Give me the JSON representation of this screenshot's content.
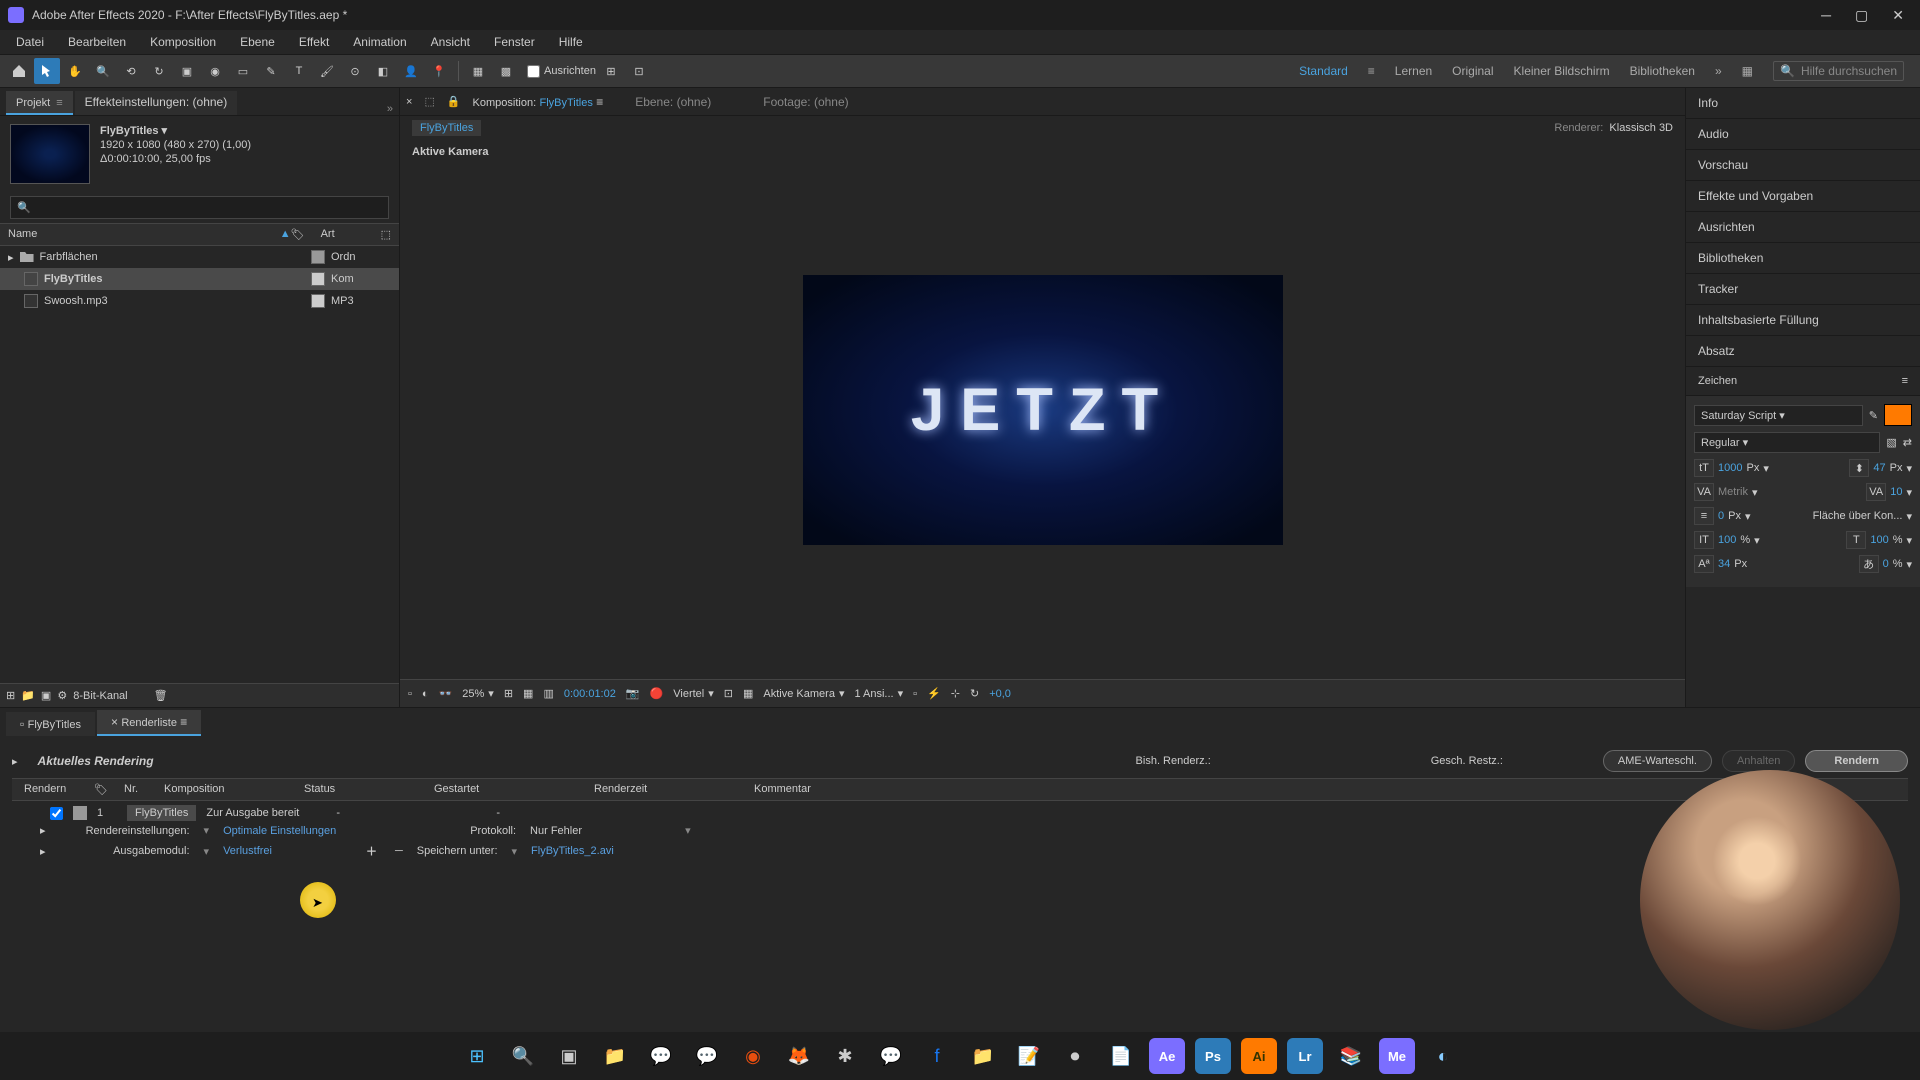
{
  "titlebar": {
    "title": "Adobe After Effects 2020 - F:\\After Effects\\FlyByTitles.aep *"
  },
  "menu": [
    "Datei",
    "Bearbeiten",
    "Komposition",
    "Ebene",
    "Effekt",
    "Animation",
    "Ansicht",
    "Fenster",
    "Hilfe"
  ],
  "toolbar": {
    "snap_label": "Ausrichten",
    "search_placeholder": "Hilfe durchsuchen"
  },
  "workspaces": {
    "items": [
      "Standard",
      "Lernen",
      "Original",
      "Kleiner Bildschirm",
      "Bibliotheken"
    ],
    "active": "Standard"
  },
  "project": {
    "tab_project": "Projekt",
    "tab_effects": "Effekteinstellungen: (ohne)",
    "comp_name": "FlyByTitles",
    "comp_res": "1920 x 1080 (480 x 270) (1,00)",
    "comp_time": "Δ0:00:10:00, 25,00 fps",
    "col_name": "Name",
    "col_type": "Art",
    "items": [
      {
        "name": "Farbflächen",
        "type": "Ordn",
        "kind": "folder"
      },
      {
        "name": "FlyByTitles",
        "type": "Kom",
        "kind": "comp",
        "selected": true
      },
      {
        "name": "Swoosh.mp3",
        "type": "MP3",
        "kind": "audio"
      }
    ],
    "footer_bit": "8-Bit-Kanal"
  },
  "comp": {
    "tab_comp_prefix": "Komposition:",
    "tab_comp_name": "FlyByTitles",
    "tab_layer": "Ebene: (ohne)",
    "tab_footage": "Footage: (ohne)",
    "crumb": "FlyByTitles",
    "renderer_label": "Renderer:",
    "renderer_value": "Klassisch 3D",
    "active_cam": "Aktive Kamera",
    "display_text": "JETZT",
    "zoom": "25%",
    "timecode": "0:00:01:02",
    "res": "Viertel",
    "cam": "Aktive Kamera",
    "views": "1 Ansi...",
    "exposure": "+0,0"
  },
  "right_panels": [
    "Info",
    "Audio",
    "Vorschau",
    "Effekte und Vorgaben",
    "Ausrichten",
    "Bibliotheken",
    "Tracker",
    "Inhaltsbasierte Füllung",
    "Absatz"
  ],
  "zeichen": {
    "title": "Zeichen",
    "font": "Saturday Script",
    "style": "Regular",
    "size": "1000",
    "size_unit": "Px",
    "leading": "47",
    "leading_unit": "Px",
    "kerning": "Metrik",
    "tracking": "10",
    "stroke": "0",
    "stroke_unit": "Px",
    "fill_over": "Fläche über Kon...",
    "vscale": "100",
    "vscale_unit": "%",
    "hscale": "100",
    "hscale_unit": "%",
    "baseline": "34",
    "baseline_unit": "Px",
    "tsume": "0",
    "tsume_unit": "%"
  },
  "render": {
    "tab_comp": "FlyByTitles",
    "tab_queue": "Renderliste",
    "current_label": "Aktuelles Rendering",
    "bish": "Bish. Renderz.:",
    "rest": "Gesch. Restz.:",
    "btn_ame": "AME-Warteschl.",
    "btn_pause": "Anhalten",
    "btn_render": "Rendern",
    "col_render": "Rendern",
    "col_nr": "Nr.",
    "col_comp": "Komposition",
    "col_status": "Status",
    "col_start": "Gestartet",
    "col_time": "Renderzeit",
    "col_comment": "Kommentar",
    "item": {
      "nr": "1",
      "comp": "FlyByTitles",
      "status": "Zur Ausgabe bereit",
      "started": "-",
      "time": "-",
      "settings_label": "Rendereinstellungen:",
      "settings_value": "Optimale Einstellungen",
      "proto_label": "Protokoll:",
      "proto_value": "Nur Fehler",
      "output_label": "Ausgabemodul:",
      "output_value": "Verlustfrei",
      "save_label": "Speichern unter:",
      "save_value": "FlyByTitles_2.avi"
    }
  }
}
